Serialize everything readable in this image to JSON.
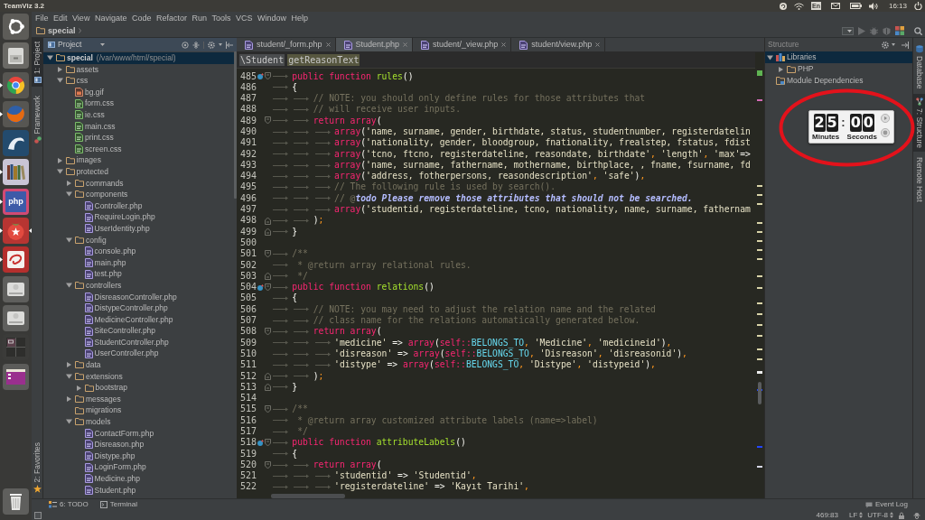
{
  "top_panel": {
    "title": "TeamViz 3.2",
    "keyboard_layout": "En",
    "clock": "16:13"
  },
  "launcher": {
    "items": [
      {
        "kind": "dash",
        "running": false,
        "focused": false
      },
      {
        "kind": "files",
        "running": false,
        "focused": false
      },
      {
        "kind": "web",
        "running": true,
        "focused": false
      },
      {
        "kind": "fox",
        "running": true,
        "focused": false
      },
      {
        "kind": "database",
        "running": false,
        "focused": false
      },
      {
        "kind": "books",
        "running": true,
        "focused": false
      },
      {
        "kind": "ide",
        "label": "php",
        "running": true,
        "focused": false
      },
      {
        "kind": "tomato",
        "running": true,
        "focused": true
      },
      {
        "kind": "swirl",
        "running": true,
        "focused": false
      },
      {
        "kind": "disk",
        "running": false,
        "focused": false
      },
      {
        "kind": "disk",
        "running": false,
        "focused": false
      },
      {
        "kind": "workspaces",
        "running": false,
        "focused": false
      },
      {
        "kind": "window",
        "running": false,
        "focused": false
      }
    ],
    "bottom": [
      {
        "kind": "trash",
        "running": false,
        "focused": false
      }
    ]
  },
  "menu": [
    "File",
    "Edit",
    "View",
    "Navigate",
    "Code",
    "Refactor",
    "Run",
    "Tools",
    "VCS",
    "Window",
    "Help"
  ],
  "navbar": {
    "breadcrumb": "special",
    "toolbar": [
      {
        "kind": "config",
        "disabled": false
      },
      {
        "kind": "run",
        "disabled": true
      },
      {
        "kind": "debug",
        "disabled": true
      },
      {
        "kind": "coverage",
        "disabled": true
      },
      {
        "kind": "blocks",
        "disabled": false
      },
      {
        "kind": "search",
        "disabled": false
      }
    ]
  },
  "left_strip": {
    "top": [
      {
        "kind": "project",
        "label": "1: Project",
        "active": true
      },
      {
        "kind": "framework",
        "label": "Framework",
        "active": false
      }
    ],
    "bottom": [
      {
        "kind": "favorites",
        "label": "2: Favorites",
        "active": false
      }
    ]
  },
  "project": {
    "title": "Project",
    "tree": [
      {
        "kind": "folder",
        "name": "special",
        "path": "(/var/www/html/special)",
        "expanded": true,
        "selected": true,
        "children": [
          {
            "kind": "folder",
            "name": "assets",
            "expanded": false,
            "selected": false
          },
          {
            "kind": "folder",
            "name": "css",
            "expanded": true,
            "selected": false,
            "children": [
              {
                "kind": "image",
                "name": "bg.gif",
                "selected": false
              },
              {
                "kind": "css",
                "name": "form.css",
                "selected": false
              },
              {
                "kind": "css",
                "name": "ie.css",
                "selected": false
              },
              {
                "kind": "css",
                "name": "main.css",
                "selected": false
              },
              {
                "kind": "css",
                "name": "print.css",
                "selected": false
              },
              {
                "kind": "css",
                "name": "screen.css",
                "selected": false
              }
            ]
          },
          {
            "kind": "folder",
            "name": "images",
            "expanded": false,
            "selected": false
          },
          {
            "kind": "folder",
            "name": "protected",
            "expanded": true,
            "selected": false,
            "children": [
              {
                "kind": "folder",
                "name": "commands",
                "expanded": false,
                "selected": false
              },
              {
                "kind": "folder",
                "name": "components",
                "expanded": true,
                "selected": false,
                "children": [
                  {
                    "kind": "php",
                    "name": "Controller.php",
                    "selected": false
                  },
                  {
                    "kind": "php",
                    "name": "RequireLogin.php",
                    "selected": false
                  },
                  {
                    "kind": "php",
                    "name": "UserIdentity.php",
                    "selected": false
                  }
                ]
              },
              {
                "kind": "folder",
                "name": "config",
                "expanded": true,
                "selected": false,
                "children": [
                  {
                    "kind": "php",
                    "name": "console.php",
                    "selected": false
                  },
                  {
                    "kind": "php",
                    "name": "main.php",
                    "selected": false
                  },
                  {
                    "kind": "php",
                    "name": "test.php",
                    "selected": false
                  }
                ]
              },
              {
                "kind": "folder",
                "name": "controllers",
                "expanded": true,
                "selected": false,
                "children": [
                  {
                    "kind": "php",
                    "name": "DisreasonController.php",
                    "selected": false
                  },
                  {
                    "kind": "php",
                    "name": "DistypeController.php",
                    "selected": false
                  },
                  {
                    "kind": "php",
                    "name": "MedicineController.php",
                    "selected": false
                  },
                  {
                    "kind": "php",
                    "name": "SiteController.php",
                    "selected": false
                  },
                  {
                    "kind": "php",
                    "name": "StudentController.php",
                    "selected": false
                  },
                  {
                    "kind": "php",
                    "name": "UserController.php",
                    "selected": false
                  }
                ]
              },
              {
                "kind": "folder",
                "name": "data",
                "expanded": false,
                "selected": false
              },
              {
                "kind": "folder",
                "name": "extensions",
                "expanded": true,
                "selected": false,
                "children": [
                  {
                    "kind": "folder",
                    "name": "bootstrap",
                    "expanded": false,
                    "selected": false
                  }
                ]
              },
              {
                "kind": "folder",
                "name": "messages",
                "expanded": false,
                "selected": false
              },
              {
                "kind": "emptyfolder",
                "name": "migrations",
                "selected": false
              },
              {
                "kind": "folder",
                "name": "models",
                "expanded": true,
                "selected": false,
                "children": [
                  {
                    "kind": "php",
                    "name": "ContactForm.php",
                    "selected": false
                  },
                  {
                    "kind": "php",
                    "name": "Disreason.php",
                    "selected": false
                  },
                  {
                    "kind": "php",
                    "name": "Distype.php",
                    "selected": false
                  },
                  {
                    "kind": "php",
                    "name": "LoginForm.php",
                    "selected": false
                  },
                  {
                    "kind": "php",
                    "name": "Medicine.php",
                    "selected": false
                  },
                  {
                    "kind": "php",
                    "name": "Student.php",
                    "selected": false
                  }
                ]
              }
            ]
          }
        ]
      }
    ]
  },
  "editor": {
    "tabs": [
      {
        "label": "student/_form.php",
        "selected": false
      },
      {
        "label": "Student.php",
        "selected": true
      },
      {
        "label": "student/_view.php",
        "selected": false
      },
      {
        "label": "student/view.php",
        "selected": false
      }
    ],
    "breadcrumbs": [
      {
        "label": "\\Student",
        "selected": false
      },
      {
        "label": "getReasonText",
        "selected": true
      }
    ],
    "lines": [
      {
        "number": "485",
        "indent": [
          {
            "kind": "tab"
          }
        ],
        "gutter_icon": {
          "kind": "override"
        },
        "fold": {
          "kind": "open"
        },
        "tokens": [
          {
            "kind": "keyword",
            "text": "public function "
          },
          {
            "kind": "function",
            "text": "rules"
          },
          {
            "kind": "plain",
            "text": "()"
          }
        ]
      },
      {
        "number": "486",
        "indent": [
          {
            "kind": "tab"
          }
        ],
        "tokens": [
          {
            "kind": "plain",
            "text": "{"
          }
        ]
      },
      {
        "number": "487",
        "indent": [
          {
            "kind": "tab"
          },
          {
            "kind": "tab"
          }
        ],
        "tokens": [
          {
            "kind": "comment",
            "text": "// NOTE: you should only define rules for those attributes that"
          }
        ]
      },
      {
        "number": "488",
        "indent": [
          {
            "kind": "tab"
          },
          {
            "kind": "tab"
          }
        ],
        "tokens": [
          {
            "kind": "comment",
            "text": "// will receive user inputs."
          }
        ]
      },
      {
        "number": "489",
        "indent": [
          {
            "kind": "tab"
          },
          {
            "kind": "tab"
          }
        ],
        "fold": {
          "kind": "open"
        },
        "tokens": [
          {
            "kind": "keyword",
            "text": "return array"
          },
          {
            "kind": "plain",
            "text": "("
          }
        ]
      },
      {
        "number": "490",
        "indent": [
          {
            "kind": "tab"
          },
          {
            "kind": "tab"
          },
          {
            "kind": "tab"
          }
        ],
        "tokens": [
          {
            "kind": "keyword",
            "text": "array"
          },
          {
            "kind": "plain",
            "text": "("
          },
          {
            "kind": "string",
            "text": "'name, surname, gender, birthdate, status, studentnumber, registerdatelin"
          }
        ]
      },
      {
        "number": "491",
        "indent": [
          {
            "kind": "tab"
          },
          {
            "kind": "tab"
          },
          {
            "kind": "tab"
          }
        ],
        "tokens": [
          {
            "kind": "keyword",
            "text": "array"
          },
          {
            "kind": "plain",
            "text": "("
          },
          {
            "kind": "string",
            "text": "'nationality, gender, bloodgroup, fnationality, frealstep, fstatus, fdist"
          }
        ]
      },
      {
        "number": "492",
        "indent": [
          {
            "kind": "tab"
          },
          {
            "kind": "tab"
          },
          {
            "kind": "tab"
          }
        ],
        "tokens": [
          {
            "kind": "keyword",
            "text": "array"
          },
          {
            "kind": "plain",
            "text": "("
          },
          {
            "kind": "string",
            "text": "'tcno, ftcno, registerdateline, reasondate, birthdate'"
          },
          {
            "kind": "punct",
            "text": ", "
          },
          {
            "kind": "string",
            "text": "'length'"
          },
          {
            "kind": "punct",
            "text": ", "
          },
          {
            "kind": "string",
            "text": "'max'"
          },
          {
            "kind": "plain",
            "text": "=>"
          }
        ]
      },
      {
        "number": "493",
        "indent": [
          {
            "kind": "tab"
          },
          {
            "kind": "tab"
          },
          {
            "kind": "tab"
          }
        ],
        "tokens": [
          {
            "kind": "keyword",
            "text": "array"
          },
          {
            "kind": "plain",
            "text": "("
          },
          {
            "kind": "string",
            "text": "'name, surname, fathername, mothername, birthplace, , fname, fsurname, fd"
          }
        ]
      },
      {
        "number": "494",
        "indent": [
          {
            "kind": "tab"
          },
          {
            "kind": "tab"
          },
          {
            "kind": "tab"
          }
        ],
        "tokens": [
          {
            "kind": "keyword",
            "text": "array"
          },
          {
            "kind": "plain",
            "text": "("
          },
          {
            "kind": "string",
            "text": "'address, fotherpersons, reasondescription'"
          },
          {
            "kind": "punct",
            "text": ", "
          },
          {
            "kind": "string",
            "text": "'safe'"
          },
          {
            "kind": "plain",
            "text": ")"
          },
          {
            "kind": "punct",
            "text": ","
          }
        ]
      },
      {
        "number": "495",
        "indent": [
          {
            "kind": "tab"
          },
          {
            "kind": "tab"
          },
          {
            "kind": "tab"
          }
        ],
        "tokens": [
          {
            "kind": "comment",
            "text": "// The following rule is used by search()."
          }
        ]
      },
      {
        "number": "496",
        "indent": [
          {
            "kind": "tab"
          },
          {
            "kind": "tab"
          },
          {
            "kind": "tab"
          }
        ],
        "tokens": [
          {
            "kind": "comment",
            "text": "// @"
          },
          {
            "kind": "todo",
            "text": "todo Please remove those attributes that should not be searched."
          }
        ]
      },
      {
        "number": "497",
        "indent": [
          {
            "kind": "tab"
          },
          {
            "kind": "tab"
          },
          {
            "kind": "tab"
          }
        ],
        "tokens": [
          {
            "kind": "keyword",
            "text": "array"
          },
          {
            "kind": "plain",
            "text": "("
          },
          {
            "kind": "string",
            "text": "'studentid, registerdateline, tcno, nationality, name, surname, fathernam"
          }
        ]
      },
      {
        "number": "498",
        "indent": [
          {
            "kind": "tab"
          },
          {
            "kind": "tab"
          }
        ],
        "fold": {
          "kind": "close"
        },
        "tokens": [
          {
            "kind": "plain",
            "text": ")"
          },
          {
            "kind": "punct",
            "text": ";"
          }
        ]
      },
      {
        "number": "499",
        "indent": [
          {
            "kind": "tab"
          }
        ],
        "fold": {
          "kind": "close"
        },
        "tokens": [
          {
            "kind": "plain",
            "text": "}"
          }
        ]
      },
      {
        "number": "500"
      },
      {
        "number": "501",
        "indent": [
          {
            "kind": "tab"
          }
        ],
        "fold": {
          "kind": "open"
        },
        "tokens": [
          {
            "kind": "comment",
            "text": "/**"
          }
        ]
      },
      {
        "number": "502",
        "indent": [
          {
            "kind": "tab"
          }
        ],
        "tokens": [
          {
            "kind": "comment",
            "text": " * @return array relational rules."
          }
        ]
      },
      {
        "number": "503",
        "indent": [
          {
            "kind": "tab"
          }
        ],
        "fold": {
          "kind": "close"
        },
        "tokens": [
          {
            "kind": "comment",
            "text": " */"
          }
        ]
      },
      {
        "number": "504",
        "indent": [
          {
            "kind": "tab"
          }
        ],
        "gutter_icon": {
          "kind": "override"
        },
        "fold": {
          "kind": "open"
        },
        "tokens": [
          {
            "kind": "keyword",
            "text": "public function "
          },
          {
            "kind": "function",
            "text": "relations"
          },
          {
            "kind": "plain",
            "text": "()"
          }
        ]
      },
      {
        "number": "505",
        "indent": [
          {
            "kind": "tab"
          }
        ],
        "tokens": [
          {
            "kind": "plain",
            "text": "{"
          }
        ]
      },
      {
        "number": "506",
        "indent": [
          {
            "kind": "tab"
          },
          {
            "kind": "tab"
          }
        ],
        "tokens": [
          {
            "kind": "comment",
            "text": "// NOTE: you may need to adjust the relation name and the related"
          }
        ]
      },
      {
        "number": "507",
        "indent": [
          {
            "kind": "tab"
          },
          {
            "kind": "tab"
          }
        ],
        "tokens": [
          {
            "kind": "comment",
            "text": "// class name for the relations automatically generated below."
          }
        ]
      },
      {
        "number": "508",
        "indent": [
          {
            "kind": "tab"
          },
          {
            "kind": "tab"
          }
        ],
        "fold": {
          "kind": "open"
        },
        "tokens": [
          {
            "kind": "keyword",
            "text": "return array"
          },
          {
            "kind": "plain",
            "text": "("
          }
        ]
      },
      {
        "number": "509",
        "indent": [
          {
            "kind": "tab"
          },
          {
            "kind": "tab"
          },
          {
            "kind": "tab"
          }
        ],
        "tokens": [
          {
            "kind": "string",
            "text": "'medicine'"
          },
          {
            "kind": "plain",
            "text": " => "
          },
          {
            "kind": "keyword",
            "text": "array"
          },
          {
            "kind": "plain",
            "text": "("
          },
          {
            "kind": "keyword",
            "text": "self::"
          },
          {
            "kind": "constant",
            "text": "BELONGS_TO"
          },
          {
            "kind": "punct",
            "text": ", "
          },
          {
            "kind": "string",
            "text": "'Medicine'"
          },
          {
            "kind": "punct",
            "text": ", "
          },
          {
            "kind": "string",
            "text": "'medicineid'"
          },
          {
            "kind": "plain",
            "text": ")"
          },
          {
            "kind": "punct",
            "text": ","
          }
        ]
      },
      {
        "number": "510",
        "indent": [
          {
            "kind": "tab"
          },
          {
            "kind": "tab"
          },
          {
            "kind": "tab"
          }
        ],
        "tokens": [
          {
            "kind": "string",
            "text": "'disreason'"
          },
          {
            "kind": "plain",
            "text": " => "
          },
          {
            "kind": "keyword",
            "text": "array"
          },
          {
            "kind": "plain",
            "text": "("
          },
          {
            "kind": "keyword",
            "text": "self::"
          },
          {
            "kind": "constant",
            "text": "BELONGS_TO"
          },
          {
            "kind": "punct",
            "text": ", "
          },
          {
            "kind": "string",
            "text": "'Disreason'"
          },
          {
            "kind": "punct",
            "text": ", "
          },
          {
            "kind": "string",
            "text": "'disreasonid'"
          },
          {
            "kind": "plain",
            "text": ")"
          },
          {
            "kind": "punct",
            "text": ","
          }
        ]
      },
      {
        "number": "511",
        "indent": [
          {
            "kind": "tab"
          },
          {
            "kind": "tab"
          },
          {
            "kind": "tab"
          }
        ],
        "tokens": [
          {
            "kind": "string",
            "text": "'distype'"
          },
          {
            "kind": "plain",
            "text": " => "
          },
          {
            "kind": "keyword",
            "text": "array"
          },
          {
            "kind": "plain",
            "text": "("
          },
          {
            "kind": "keyword",
            "text": "self::"
          },
          {
            "kind": "constant",
            "text": "BELONGS_TO"
          },
          {
            "kind": "punct",
            "text": ", "
          },
          {
            "kind": "string",
            "text": "'Distype'"
          },
          {
            "kind": "punct",
            "text": ", "
          },
          {
            "kind": "string",
            "text": "'distypeid'"
          },
          {
            "kind": "plain",
            "text": ")"
          },
          {
            "kind": "punct",
            "text": ","
          }
        ]
      },
      {
        "number": "512",
        "indent": [
          {
            "kind": "tab"
          },
          {
            "kind": "tab"
          }
        ],
        "fold": {
          "kind": "close"
        },
        "tokens": [
          {
            "kind": "plain",
            "text": ")"
          },
          {
            "kind": "punct",
            "text": ";"
          }
        ]
      },
      {
        "number": "513",
        "indent": [
          {
            "kind": "tab"
          }
        ],
        "fold": {
          "kind": "close"
        },
        "tokens": [
          {
            "kind": "plain",
            "text": "}"
          }
        ]
      },
      {
        "number": "514"
      },
      {
        "number": "515",
        "indent": [
          {
            "kind": "tab"
          }
        ],
        "fold": {
          "kind": "open"
        },
        "tokens": [
          {
            "kind": "comment",
            "text": "/**"
          }
        ]
      },
      {
        "number": "516",
        "indent": [
          {
            "kind": "tab"
          }
        ],
        "tokens": [
          {
            "kind": "comment",
            "text": " * @return array customized attribute labels (name=>label)"
          }
        ]
      },
      {
        "number": "517",
        "indent": [
          {
            "kind": "tab"
          }
        ],
        "tokens": [
          {
            "kind": "comment",
            "text": " */"
          }
        ]
      },
      {
        "number": "518",
        "indent": [
          {
            "kind": "tab"
          }
        ],
        "gutter_icon": {
          "kind": "override"
        },
        "fold": {
          "kind": "open"
        },
        "tokens": [
          {
            "kind": "keyword",
            "text": "public function "
          },
          {
            "kind": "function",
            "text": "attributeLabels"
          },
          {
            "kind": "plain",
            "text": "()"
          }
        ]
      },
      {
        "number": "519",
        "indent": [
          {
            "kind": "tab"
          }
        ],
        "tokens": [
          {
            "kind": "plain",
            "text": "{"
          }
        ]
      },
      {
        "number": "520",
        "indent": [
          {
            "kind": "tab"
          },
          {
            "kind": "tab"
          }
        ],
        "fold": {
          "kind": "open"
        },
        "tokens": [
          {
            "kind": "keyword",
            "text": "return array"
          },
          {
            "kind": "plain",
            "text": "("
          }
        ]
      },
      {
        "number": "521",
        "indent": [
          {
            "kind": "tab"
          },
          {
            "kind": "tab"
          },
          {
            "kind": "tab"
          }
        ],
        "tokens": [
          {
            "kind": "string",
            "text": "'studentid'"
          },
          {
            "kind": "plain",
            "text": " => "
          },
          {
            "kind": "string",
            "text": "'Studentid'"
          },
          {
            "kind": "punct",
            "text": ","
          }
        ]
      },
      {
        "number": "522",
        "indent": [
          {
            "kind": "tab"
          },
          {
            "kind": "tab"
          },
          {
            "kind": "tab"
          }
        ],
        "tokens": [
          {
            "kind": "string",
            "text": "'registerdateline'"
          },
          {
            "kind": "plain",
            "text": " => "
          },
          {
            "kind": "string",
            "text": "'Kayıt Tarihi'"
          },
          {
            "kind": "punct",
            "text": ","
          }
        ]
      }
    ]
  },
  "structure": {
    "title": "Structure",
    "tree": [
      {
        "kind": "library",
        "name": "Libraries",
        "expanded": true,
        "selected": true,
        "children": [
          {
            "kind": "folder",
            "name": "PHP",
            "expanded": false,
            "selected": false
          }
        ]
      },
      {
        "kind": "module",
        "name": "Module Dependencies",
        "selected": false
      }
    ]
  },
  "right_strip": [
    {
      "kind": "database",
      "label": "Database",
      "active": false
    },
    {
      "kind": "structure",
      "label": "7: Structure",
      "active": true
    },
    {
      "kind": "remote",
      "label": "Remote Host",
      "active": false
    }
  ],
  "timer": {
    "minutes": [
      "2",
      "5"
    ],
    "separator": ":",
    "seconds": [
      "0",
      "0"
    ],
    "minutes_label": "Minutes",
    "seconds_label": "Seconds"
  },
  "bottom_bar": {
    "tools": [
      {
        "kind": "todo",
        "label": "6: TODO"
      },
      {
        "kind": "terminal",
        "label": "Terminal"
      }
    ],
    "event_log": "Event Log"
  },
  "status_bar": {
    "position": "469:83",
    "line_separator": "LF",
    "encoding": "UTF-8"
  }
}
